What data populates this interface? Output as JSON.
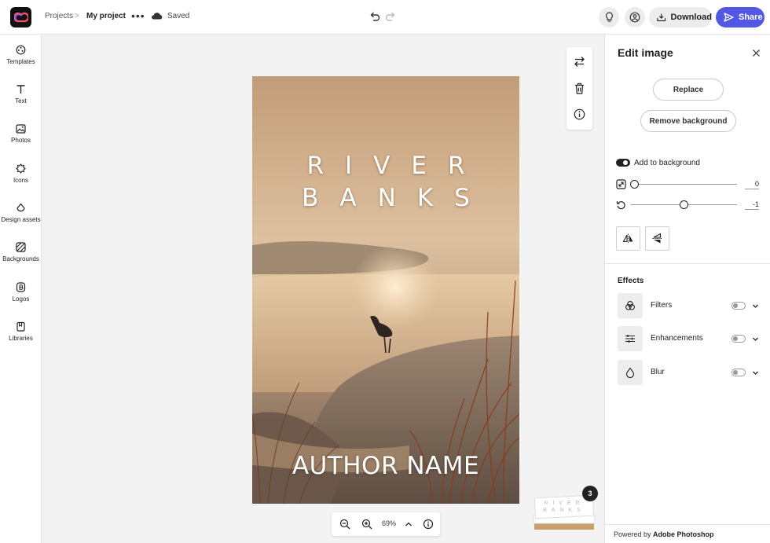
{
  "header": {
    "breadcrumb_projects": "Projects",
    "breadcrumb_separator": ">",
    "project_name": "My project",
    "more_label": "•••",
    "save_status": "Saved",
    "download_label": "Download",
    "share_label": "Share"
  },
  "rail": {
    "items": [
      {
        "label": "Templates",
        "icon": "templates-icon"
      },
      {
        "label": "Text",
        "icon": "text-icon"
      },
      {
        "label": "Photos",
        "icon": "photos-icon"
      },
      {
        "label": "Icons",
        "icon": "icons-icon"
      },
      {
        "label": "Design assets",
        "icon": "design-assets-icon"
      },
      {
        "label": "Backgrounds",
        "icon": "backgrounds-icon"
      },
      {
        "label": "Logos",
        "icon": "logos-icon"
      },
      {
        "label": "Libraries",
        "icon": "libraries-icon"
      }
    ]
  },
  "canvas": {
    "title_line1": "RIVER",
    "title_line2": "BANKS",
    "author": "AUTHOR NAME",
    "zoom_value": "69%",
    "page_count": "3"
  },
  "panel": {
    "title": "Edit image",
    "replace_label": "Replace",
    "remove_bg_label": "Remove background",
    "add_to_bg_label": "Add to background",
    "add_to_bg_on": true,
    "scale_value": "0",
    "rotate_value": "-1",
    "effects_title": "Effects",
    "effects": [
      {
        "label": "Filters",
        "enabled": false
      },
      {
        "label": "Enhancements",
        "enabled": false
      },
      {
        "label": "Blur",
        "enabled": false
      }
    ],
    "footer_prefix": "Powered by",
    "footer_brand": "Adobe Photoshop"
  },
  "colors": {
    "accent": "#5258e4",
    "dark": "#222222"
  }
}
